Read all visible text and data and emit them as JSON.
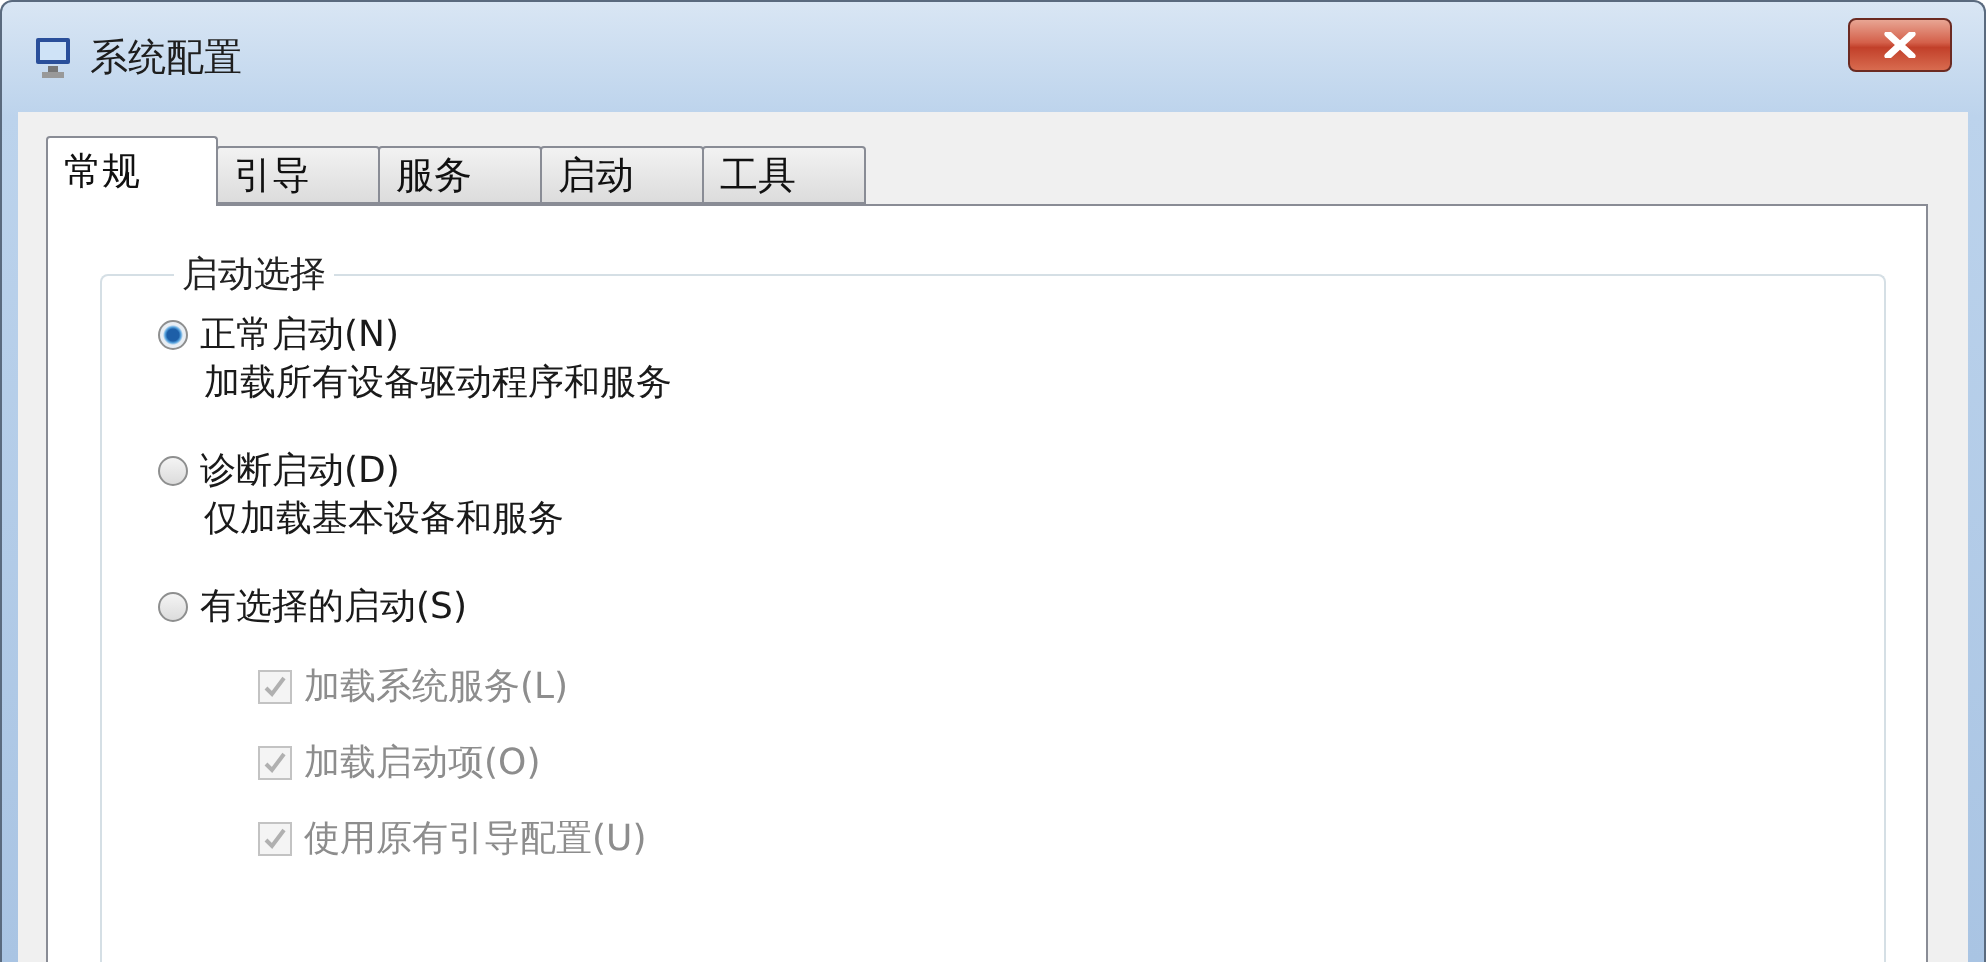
{
  "window": {
    "title": "系统配置"
  },
  "tabs": [
    {
      "label": "常规",
      "selected": true
    },
    {
      "label": "引导",
      "selected": false
    },
    {
      "label": "服务",
      "selected": false
    },
    {
      "label": "启动",
      "selected": false
    },
    {
      "label": "工具",
      "selected": false
    }
  ],
  "startup_selection": {
    "legend": "启动选择",
    "options": [
      {
        "label": "正常启动(N)",
        "description": "加载所有设备驱动程序和服务",
        "selected": true
      },
      {
        "label": "诊断启动(D)",
        "description": "仅加载基本设备和服务",
        "selected": false
      },
      {
        "label": "有选择的启动(S)",
        "selected": false
      }
    ],
    "sub_options": [
      {
        "label": "加载系统服务(L)",
        "checked": true,
        "disabled": true
      },
      {
        "label": "加载启动项(O)",
        "checked": true,
        "disabled": true
      },
      {
        "label": "使用原有引导配置(U)",
        "checked": true,
        "disabled": true
      }
    ]
  }
}
